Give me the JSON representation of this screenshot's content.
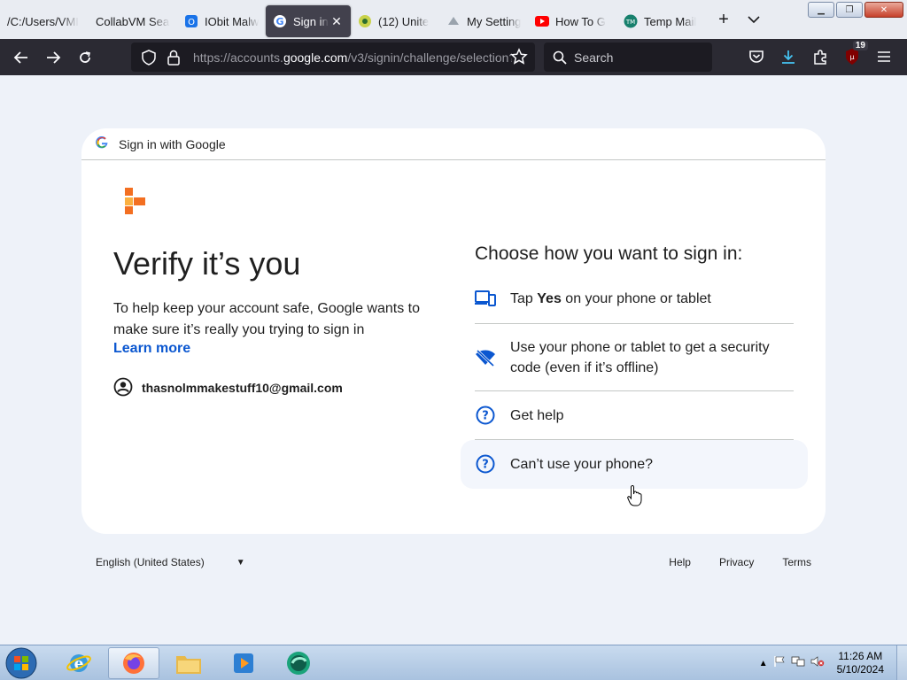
{
  "browser": {
    "tabs": [
      {
        "label": "/C:/Users/VMI",
        "icon": "file-icon"
      },
      {
        "label": "CollabVM Sear",
        "icon": "blank-icon"
      },
      {
        "label": "IObit Malw",
        "icon": "iobit-icon"
      },
      {
        "label": "Sign in",
        "icon": "google-icon",
        "active": true
      },
      {
        "label": "(12) Unite",
        "icon": "app-icon"
      },
      {
        "label": "My Setting",
        "icon": "settings-page-icon"
      },
      {
        "label": "How To G",
        "icon": "youtube-icon"
      },
      {
        "label": "Temp Mail",
        "icon": "tempmail-icon"
      }
    ],
    "url_prefix": "https://accounts.",
    "url_domain": "google.com",
    "url_suffix": "/v3/signin/challenge/selection?",
    "search_placeholder": "Search",
    "extension_badge": "19"
  },
  "page": {
    "header": "Sign in with Google",
    "title": "Verify it’s you",
    "description": "To help keep your account safe, Google wants to make sure it’s really you trying to sign in",
    "learn_more": "Learn more",
    "account_email": "thasnolmmakestuff10@gmail.com",
    "choose_heading": "Choose how you want to sign in:",
    "option1_pre": "Tap ",
    "option1_bold": "Yes",
    "option1_post": " on your phone or tablet",
    "option2": "Use your phone or tablet to get a security code (even if it’s offline)",
    "option3": "Get help",
    "option4": "Can’t use your phone?",
    "language": "English (United States)",
    "footer_links": {
      "help": "Help",
      "privacy": "Privacy",
      "terms": "Terms"
    },
    "accent_color": "#0b57d0"
  },
  "taskbar": {
    "time": "11:26 AM",
    "date": "5/10/2024"
  }
}
